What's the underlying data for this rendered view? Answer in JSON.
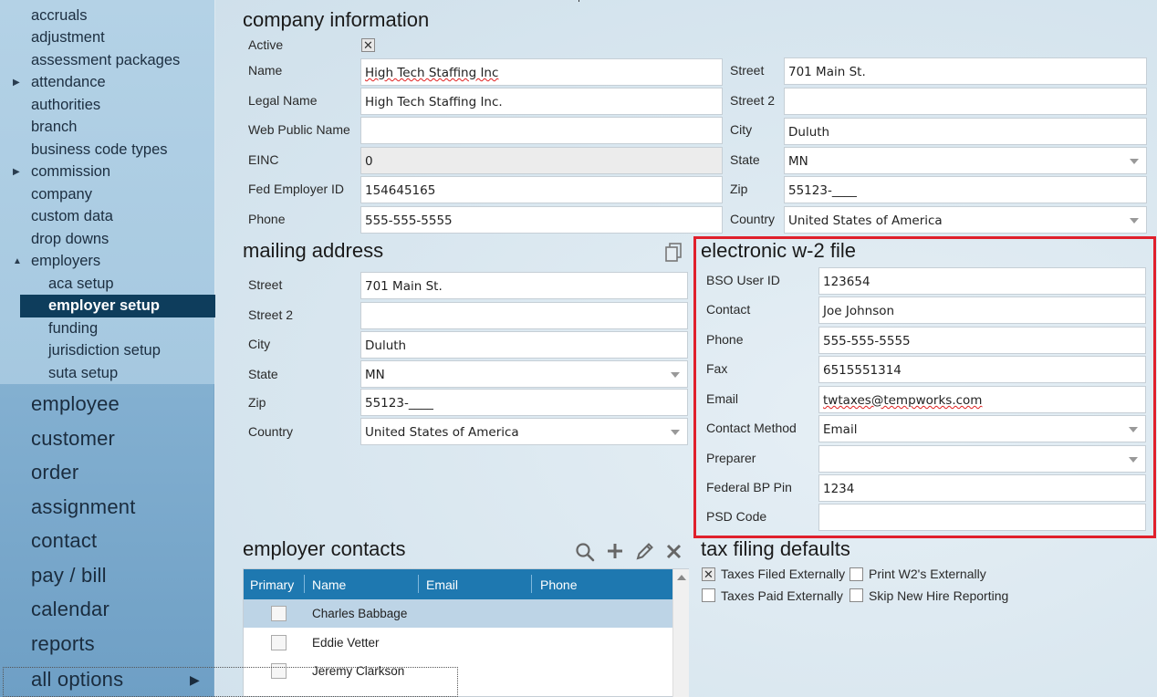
{
  "sidebar": {
    "items": [
      {
        "label": "accruals"
      },
      {
        "label": "adjustment"
      },
      {
        "label": "assessment packages"
      },
      {
        "label": "attendance"
      },
      {
        "label": "authorities"
      },
      {
        "label": "branch"
      },
      {
        "label": "business code types"
      },
      {
        "label": "commission"
      },
      {
        "label": "company"
      },
      {
        "label": "custom data"
      },
      {
        "label": "drop downs"
      },
      {
        "label": "employers"
      }
    ],
    "sub_items": [
      {
        "label": "aca setup"
      },
      {
        "label": "employer setup"
      },
      {
        "label": "funding"
      },
      {
        "label": "jurisdiction setup"
      },
      {
        "label": "suta setup"
      }
    ],
    "main_nav": [
      {
        "label": "employee"
      },
      {
        "label": "customer"
      },
      {
        "label": "order"
      },
      {
        "label": "assignment"
      },
      {
        "label": "contact"
      },
      {
        "label": "pay / bill"
      },
      {
        "label": "calendar"
      },
      {
        "label": "reports"
      },
      {
        "label": "all options"
      }
    ],
    "expand_icon": "triangle-right-icon",
    "collapse_icon": "triangle-down-icon"
  },
  "company_info": {
    "title": "company information",
    "active_label": "Active",
    "active_checked": true,
    "name_label": "Name",
    "name_value": "High Tech Staffing Inc",
    "legal_name_label": "Legal Name",
    "legal_name_value": "High Tech Staffing Inc.",
    "web_public_name_label": "Web Public Name",
    "web_public_name_value": "",
    "einc_label": "EINC",
    "einc_value": "0",
    "fed_employer_id_label": "Fed Employer ID",
    "fed_employer_id_value": "154645165",
    "phone_label": "Phone",
    "phone_value": "555-555-5555",
    "street_label": "Street",
    "street_value": "701 Main St.",
    "street2_label": "Street 2",
    "street2_value": "",
    "city_label": "City",
    "city_value": "Duluth",
    "state_label": "State",
    "state_value": "MN",
    "zip_label": "Zip",
    "zip_value": "55123-____",
    "country_label": "Country",
    "country_value": "United States of America"
  },
  "mailing": {
    "title": "mailing address",
    "copy_icon": "copy-icon",
    "street_label": "Street",
    "street_value": "701 Main St.",
    "street2_label": "Street 2",
    "street2_value": "",
    "city_label": "City",
    "city_value": "Duluth",
    "state_label": "State",
    "state_value": "MN",
    "zip_label": "Zip",
    "zip_value": "55123-____",
    "country_label": "Country",
    "country_value": "United States of America"
  },
  "w2": {
    "title": "electronic w-2 file",
    "highlight_color": "#e0202c",
    "bso_user_id_label": "BSO User ID",
    "bso_user_id_value": "123654",
    "contact_label": "Contact",
    "contact_value": "Joe Johnson",
    "phone_label": "Phone",
    "phone_value": "555-555-5555",
    "fax_label": "Fax",
    "fax_value": "6515551314",
    "email_label": "Email",
    "email_value": "twtaxes@tempworks.com",
    "contact_method_label": "Contact Method",
    "contact_method_value": "Email",
    "preparer_label": "Preparer",
    "preparer_value": "",
    "federal_bp_pin_label": "Federal BP Pin",
    "federal_bp_pin_value": "1234",
    "psd_code_label": "PSD Code",
    "psd_code_value": ""
  },
  "contacts": {
    "title": "employer contacts",
    "header_color": "#1e78b0",
    "columns": [
      "Primary",
      "Name",
      "Email",
      "Phone"
    ],
    "rows": [
      {
        "name": "Charles Babbage",
        "primary": false,
        "selected": true
      },
      {
        "name": "Eddie Vetter",
        "primary": false,
        "selected": false
      },
      {
        "name": "Jeremy Clarkson",
        "primary": false,
        "selected": false
      }
    ],
    "icons": [
      "search-icon",
      "plus-icon",
      "pencil-icon",
      "close-icon"
    ]
  },
  "tax_defaults": {
    "title": "tax filing defaults",
    "taxes_filed_externally_label": "Taxes Filed Externally",
    "taxes_filed_externally_checked": true,
    "print_w2_externally_label": "Print W2's Externally",
    "print_w2_externally_checked": false,
    "taxes_paid_externally_label": "Taxes Paid Externally",
    "taxes_paid_externally_checked": false,
    "skip_new_hire_label": "Skip New Hire Reporting",
    "skip_new_hire_checked": false
  }
}
